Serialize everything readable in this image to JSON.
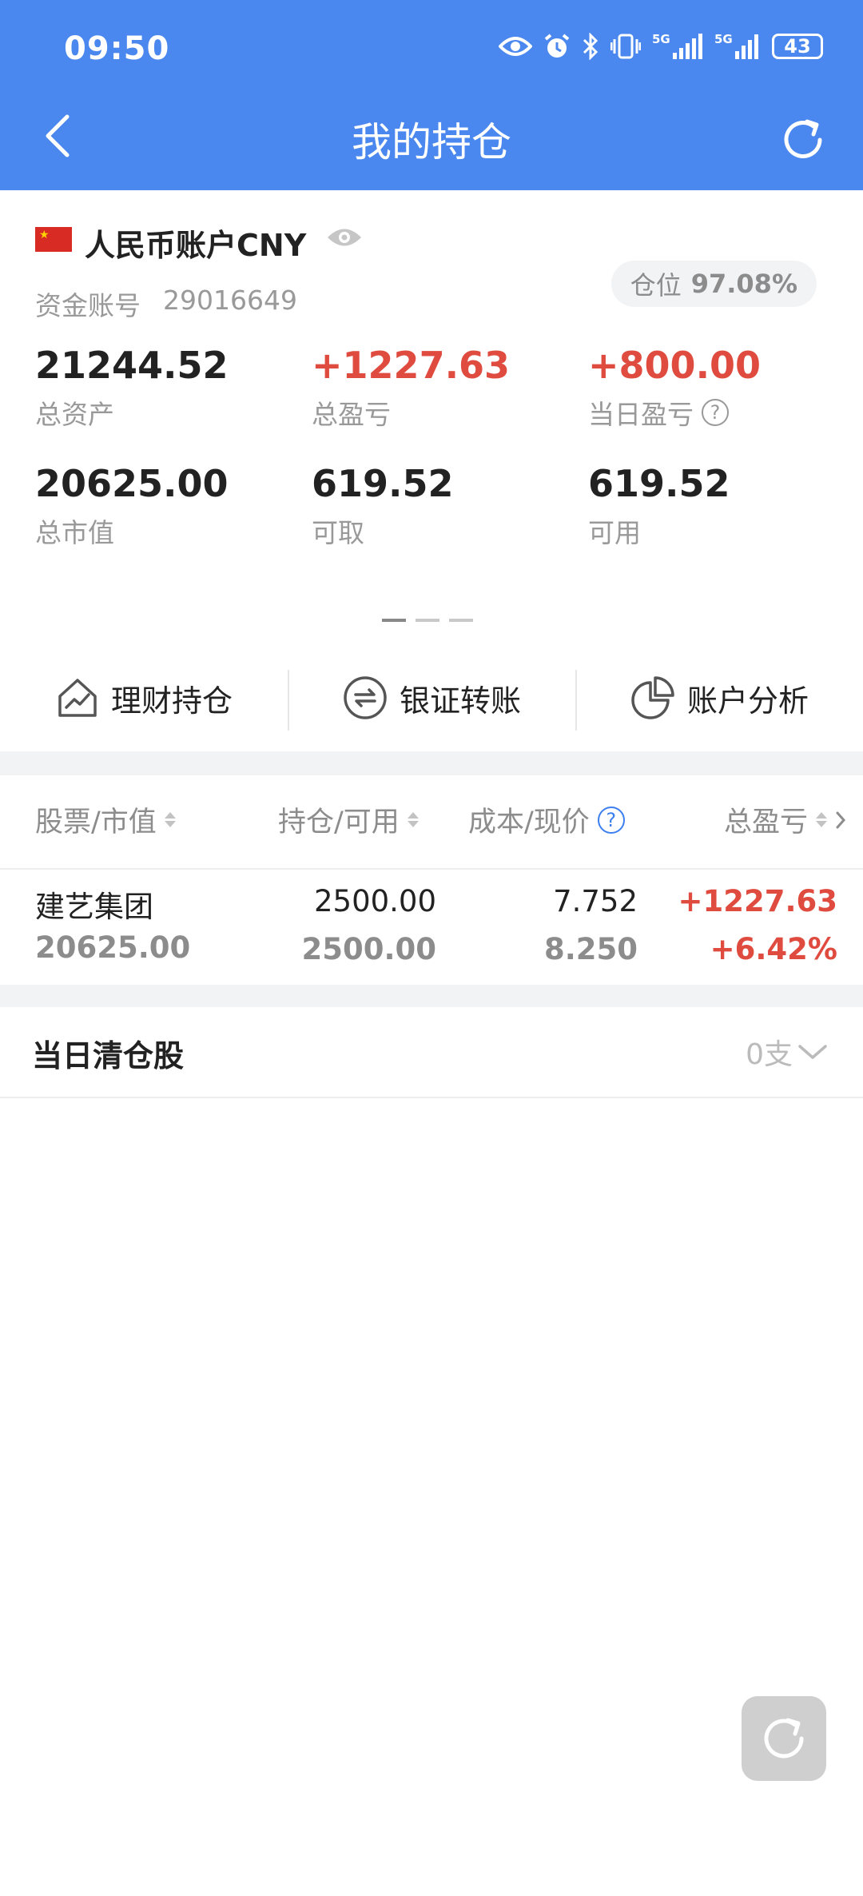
{
  "status_bar": {
    "time": "09:50",
    "battery": "43"
  },
  "header": {
    "title": "我的持仓"
  },
  "account": {
    "name": "人民币账户CNY",
    "fund_label": "资金账号",
    "fund_no": "29016649",
    "position_label": "仓位",
    "position_value": "97.08%"
  },
  "stats": [
    {
      "value": "21244.52",
      "label": "总资产"
    },
    {
      "value": "+1227.63",
      "label": "总盈亏"
    },
    {
      "value": "+800.00",
      "label": "当日盈亏"
    },
    {
      "value": "20625.00",
      "label": "总市值"
    },
    {
      "value": "619.52",
      "label": "可取"
    },
    {
      "value": "619.52",
      "label": "可用"
    }
  ],
  "actions": [
    {
      "label": "理财持仓",
      "icon": "finance-house-icon"
    },
    {
      "label": "银证转账",
      "icon": "transfer-icon"
    },
    {
      "label": "账户分析",
      "icon": "pie-chart-icon"
    }
  ],
  "table": {
    "headers": [
      "股票/市值",
      "持仓/可用",
      "成本/现价",
      "总盈亏"
    ],
    "rows": [
      {
        "name": "建艺集团",
        "market_value": "20625.00",
        "holding": "2500.00",
        "available": "2500.00",
        "cost": "7.752",
        "price": "8.250",
        "pnl": "+1227.63",
        "pnl_pct": "+6.42%"
      }
    ]
  },
  "cleared": {
    "title": "当日清仓股",
    "count": "0支"
  },
  "colors": {
    "brand": "#4a87ef",
    "gain": "#e04b3f",
    "muted": "#999999"
  }
}
